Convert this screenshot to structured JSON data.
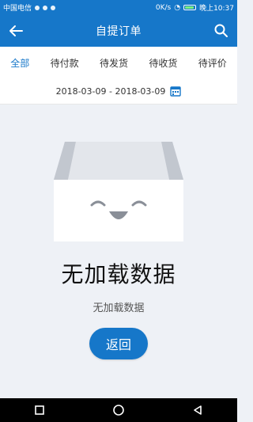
{
  "status_bar": {
    "carrier": "中国电信",
    "speed": "0K/s",
    "time": "晚上10:37",
    "battery_level": 0.7
  },
  "app_bar": {
    "title": "自提订单",
    "back_icon": "back-arrow-icon",
    "search_icon": "search-icon"
  },
  "tabs": [
    {
      "label": "全部",
      "active": true
    },
    {
      "label": "待付款",
      "active": false
    },
    {
      "label": "待发货",
      "active": false
    },
    {
      "label": "待收货",
      "active": false
    },
    {
      "label": "待评价",
      "active": false
    }
  ],
  "date_range": {
    "text": "2018-03-09 - 2018-03-09",
    "icon": "calendar-icon"
  },
  "empty_state": {
    "title": "无加载数据",
    "subtitle": "无加载数据",
    "button_label": "返回",
    "illustration": "empty-box-icon"
  },
  "nav_bar": {
    "icons": [
      "recent-apps-icon",
      "home-icon",
      "back-icon"
    ]
  },
  "colors": {
    "primary": "#1677c9",
    "page_background": "#eef1f6"
  }
}
